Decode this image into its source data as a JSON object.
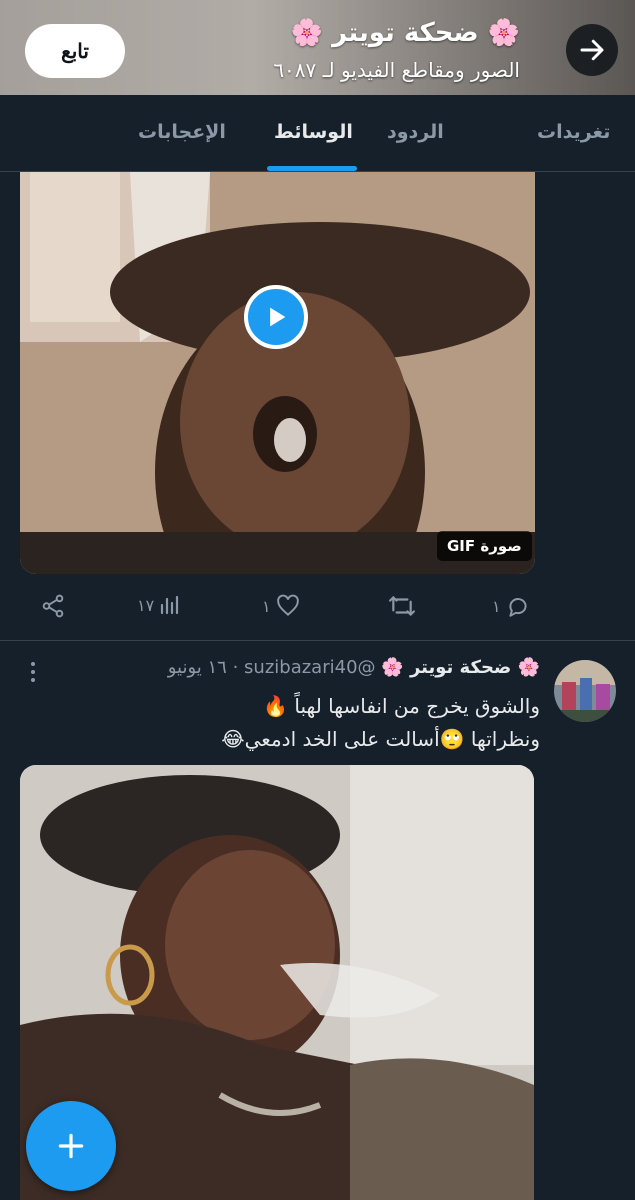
{
  "header": {
    "title": "🌸 ضحكة تويتر 🌸",
    "subtitle": "الصور ومقاطع الفيديو لـ ٦٠٨٧",
    "follow_label": "تابع",
    "back_icon": "arrow-right-icon"
  },
  "tabs": [
    {
      "label": "تغريدات",
      "active": false
    },
    {
      "label": "الردود",
      "active": false
    },
    {
      "label": "الوسائط",
      "active": true
    },
    {
      "label": "الإعجابات",
      "active": false
    }
  ],
  "tweet1": {
    "media_badge": "صورة GIF",
    "actions": {
      "reply_count": "١",
      "retweet_count": "",
      "like_count": "١",
      "views_count": "١٧"
    }
  },
  "tweet2": {
    "name": "🌸 ضحكة تويتر 🌸",
    "handle": "@suzibazari40",
    "time": "١٦ يونيو",
    "line1": "والشوق يخرج من انفاسها لهباً 🔥",
    "line2": "ونظراتها 🙄أسالت على الخد ادمعي😂"
  },
  "colors": {
    "background": "#15202b",
    "accent": "#1d9bf0",
    "muted": "#8b98a5",
    "text": "#e7e9ea"
  }
}
